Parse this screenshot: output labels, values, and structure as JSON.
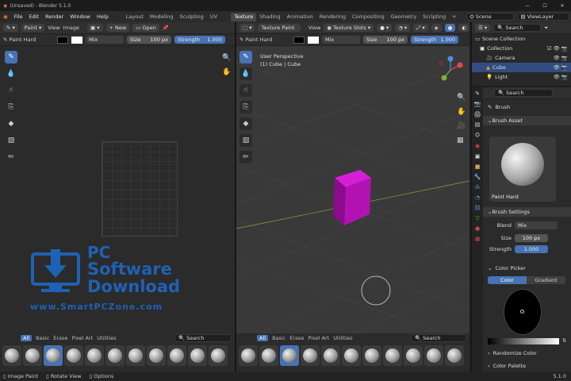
{
  "window": {
    "title": "(Unsaved) - Blender 5.1.0",
    "min": "—",
    "max": "☐",
    "close": "✕"
  },
  "menu": [
    "File",
    "Edit",
    "Render",
    "Window",
    "Help"
  ],
  "workspaces": [
    "Layout",
    "Modeling",
    "Sculpting",
    "UV Editing",
    "Texture Paint",
    "Shading",
    "Animation",
    "Rendering",
    "Compositing",
    "Geometry Nodes",
    "Scripting"
  ],
  "workspace_add": "+",
  "scene": {
    "scene_label": "Scene",
    "view_layer_label": "ViewLayer"
  },
  "image_editor": {
    "mode": "Paint",
    "menus": [
      "View",
      "Image"
    ],
    "new_label": "New",
    "open_label": "Open",
    "brush_name": "Paint Hard",
    "blend": "Mix",
    "size_label": "Size",
    "size_value": "100 px",
    "strength_label": "Strength",
    "strength_value": "1.000"
  },
  "viewport": {
    "mode": "Texture Paint",
    "menu_view": "View",
    "texture_slots": "Texture Slots",
    "brush_name": "Paint Hard",
    "blend": "Mix",
    "size_label": "Size",
    "size_value": "100 px",
    "strength_label": "Strength",
    "strength_value": "1.000",
    "overlay_line1": "User Perspective",
    "overlay_line2": "(1) Cube | Cube",
    "cube_color": "#b312b3"
  },
  "brush_bar": {
    "tabs": [
      "All",
      "Basic",
      "Erase",
      "Pixel Art",
      "Utilities"
    ],
    "search_placeholder": "Search"
  },
  "outliner": {
    "search_placeholder": "Search",
    "scene_collection": "Scene Collection",
    "collection": "Collection",
    "items": [
      "Camera",
      "Cube",
      "Light"
    ]
  },
  "properties": {
    "search_placeholder": "Search",
    "brush_header": "Brush",
    "brush_asset": "Brush Asset",
    "asset_name": "Paint Hard",
    "brush_settings": "Brush Settings",
    "blend_label": "Blend",
    "blend_value": "Mix",
    "size_label": "Size",
    "size_value": "100 px",
    "strength_label": "Strength",
    "strength_value": "1.000",
    "color_picker": "Color Picker",
    "color_tab": "Color",
    "gradient_tab": "Gradient",
    "randomize": "Randomize Color",
    "palette": "Color Palette"
  },
  "watermark": {
    "line1": "PC",
    "line2": "Software",
    "line3": "Download",
    "url": "www.SmartPCZone.com"
  },
  "status": {
    "image_paint": "Image Paint",
    "rotate_view": "Rotate View",
    "options": "Options",
    "version": "5.1.0"
  },
  "colors": {
    "accent": "#4772b3",
    "selection": "#334d80",
    "watermark_blue": "#1e62b5"
  }
}
